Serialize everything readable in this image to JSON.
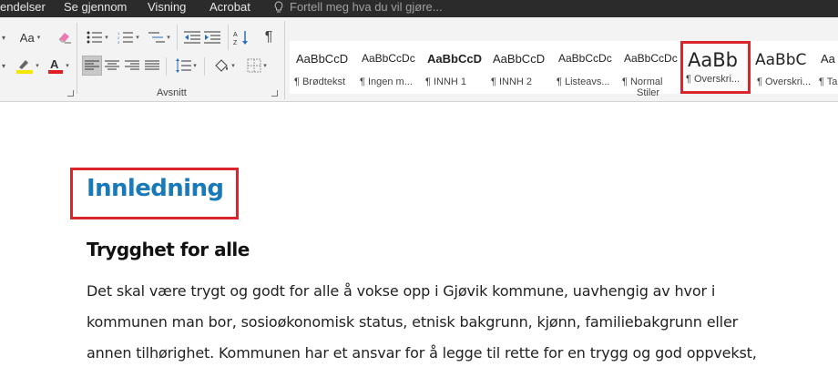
{
  "menubar": {
    "items": [
      "endelser",
      "Se gjennom",
      "Visning",
      "Acrobat"
    ],
    "tell_me": "Fortell meg hva du vil gjøre..."
  },
  "ribbon": {
    "font_case_label": "Aa",
    "group_paragraph": "Avsnitt",
    "group_styles": "Stiler",
    "styles": [
      {
        "preview": "AaBbCcD",
        "label": "¶ Brødtekst"
      },
      {
        "preview": "AaBbCcDc",
        "label": "¶ Ingen m..."
      },
      {
        "preview": "AaBbCcD",
        "label": "¶ INNH 1"
      },
      {
        "preview": "AaBbCcD",
        "label": "¶ INNH 2"
      },
      {
        "preview": "AaBbCcDc",
        "label": "¶ Listeavs..."
      },
      {
        "preview": "AaBbCcDc",
        "label": "¶ Normal"
      },
      {
        "preview": "AaBb",
        "label": "¶ Overskri..."
      },
      {
        "preview": "AaBbC",
        "label": "¶ Overskri..."
      },
      {
        "preview": "Aa",
        "label": "¶ Tal"
      }
    ],
    "colors": {
      "highlight": "#f5e700",
      "font_color": "#e02020",
      "selection": "#d9262c"
    }
  },
  "document": {
    "heading1": "Innledning",
    "heading2": "Trygghet for alle",
    "lines": [
      "Det skal være trygt og godt for alle å vokse opp i Gjøvik kommune, uavhengig av hvor i",
      "kommunen man bor, sosioøkonomisk status, etnisk bakgrunn, kjønn, familiebakgrunn eller",
      "annen tilhørighet. Kommunen har et ansvar for å legge til rette for en trygg og god oppvekst,"
    ]
  }
}
